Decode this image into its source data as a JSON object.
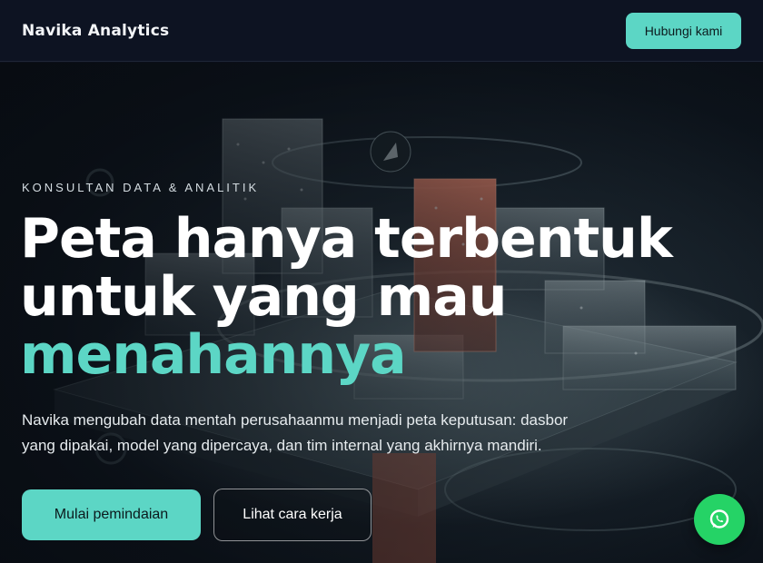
{
  "header": {
    "brand": "Navika Analytics",
    "contact_label": "Hubungi kami"
  },
  "hero": {
    "eyebrow": "KONSULTAN DATA & ANALITIK",
    "headline_line1": "Peta hanya terbentuk",
    "headline_line2": "untuk yang mau",
    "headline_accent": "menahannya",
    "lede": "Navika mengubah data mentah perusahaanmu menjadi peta keputusan: dasbor yang dipakai, model yang dipercaya, dan tim internal yang akhirnya mandiri.",
    "primary_cta": "Mulai pemindaian",
    "secondary_cta": "Lihat cara kerja",
    "background_image": "glass-city-data-visualization"
  },
  "floating": {
    "chat_icon": "whatsapp-icon"
  },
  "colors": {
    "accent": "#5cd6c5",
    "header_bg": "#0d1322",
    "whatsapp": "#25d366"
  }
}
